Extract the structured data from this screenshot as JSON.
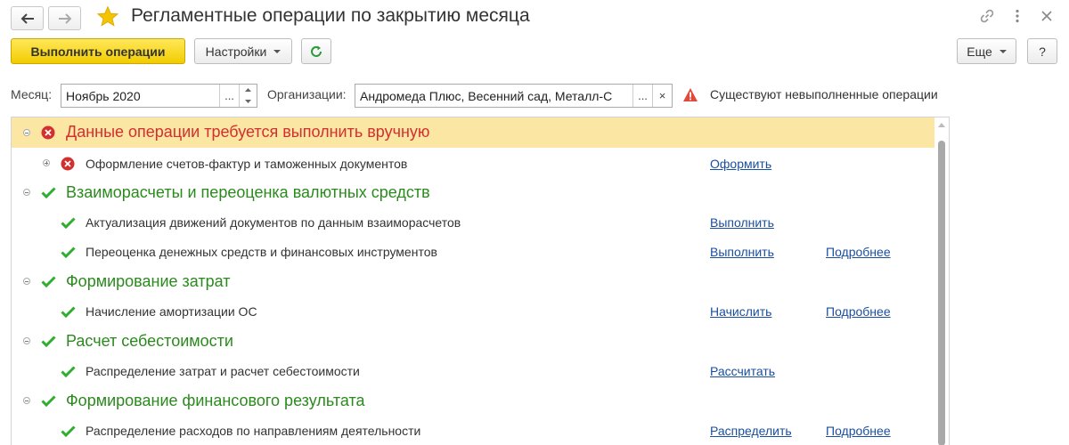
{
  "window": {
    "title": "Регламентные операции по закрытию месяца"
  },
  "toolbar": {
    "run_label": "Выполнить операции",
    "settings_label": "Настройки",
    "more_label": "Еще",
    "help_label": "?"
  },
  "filters": {
    "month_label": "Месяц:",
    "month_value": "Ноябрь 2020",
    "choose_glyph": "...",
    "org_label": "Организации:",
    "org_value": "Андромеда Плюс, Весенний сад, Металл-С",
    "clear_glyph": "×",
    "warning_text": "Существуют невыполненные операции"
  },
  "colors": {
    "accent_yellow": "#f2cc00",
    "highlight_row": "#fbe7a3",
    "group_green": "#2b8a1d",
    "error_red": "#d32f2f",
    "link_blue": "#1a4fa0"
  },
  "icons": {
    "back": "arrow-left-icon",
    "forward": "arrow-right-icon",
    "favorite": "star-icon",
    "link": "link-icon",
    "menu": "kebab-menu-icon",
    "close": "close-icon",
    "refresh": "refresh-icon",
    "warning": "warning-triangle-icon",
    "ok": "check-icon",
    "error": "error-circle-icon"
  },
  "groups": [
    {
      "label": "Данные операции требуется выполнить вручную",
      "status": "error",
      "items": [
        {
          "label": "Оформление счетов-фактур и таможенных документов",
          "status": "error",
          "action": "Оформить",
          "details": ""
        }
      ]
    },
    {
      "label": "Взаиморасчеты и переоценка валютных средств",
      "status": "ok",
      "items": [
        {
          "label": "Актуализация движений документов по данным взаиморасчетов",
          "status": "ok",
          "action": "Выполнить",
          "details": ""
        },
        {
          "label": "Переоценка денежных средств и финансовых инструментов",
          "status": "ok",
          "action": "Выполнить",
          "details": "Подробнее"
        }
      ]
    },
    {
      "label": "Формирование затрат",
      "status": "ok",
      "items": [
        {
          "label": "Начисление амортизации ОС",
          "status": "ok",
          "action": "Начислить",
          "details": "Подробнее"
        }
      ]
    },
    {
      "label": "Расчет себестоимости",
      "status": "ok",
      "items": [
        {
          "label": "Распределение затрат и расчет себестоимости",
          "status": "ok",
          "action": "Рассчитать",
          "details": ""
        }
      ]
    },
    {
      "label": "Формирование финансового результата",
      "status": "ok",
      "items": [
        {
          "label": "Распределение расходов по направлениям деятельности",
          "status": "ok",
          "action": "Распределить",
          "details": "Подробнее"
        }
      ]
    }
  ]
}
